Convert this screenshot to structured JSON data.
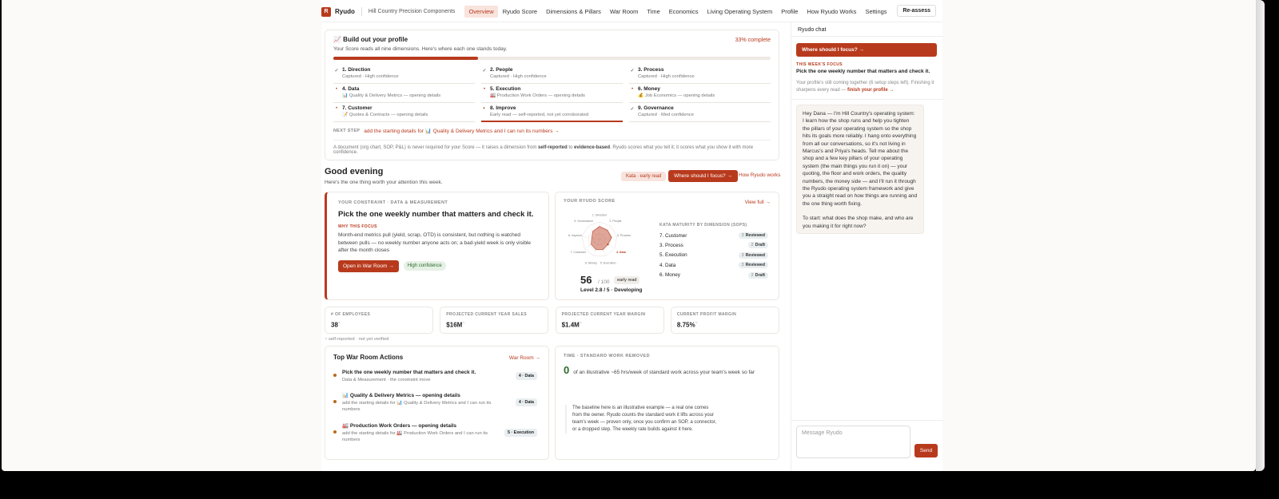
{
  "nav": {
    "logo_letter": "R",
    "brand": "Ryudo",
    "company": "Hill Country Precision Components",
    "items": [
      {
        "label": "Overview",
        "active": true
      },
      {
        "label": "Ryudo Score"
      },
      {
        "label": "Dimensions & Pillars"
      },
      {
        "label": "War Room"
      },
      {
        "label": "Time"
      },
      {
        "label": "Economics"
      },
      {
        "label": "Living Operating System"
      },
      {
        "label": "Profile"
      },
      {
        "label": "How Ryudo Works"
      },
      {
        "label": "Settings"
      }
    ],
    "reassess": "Re-assess"
  },
  "profile": {
    "title": "📈 Build out your profile",
    "percent_label": "33% complete",
    "percent": 0.33,
    "subtitle": "Your Score reads all nine dimensions. Here's where each one stands today.",
    "dimensions": [
      {
        "name": "1. Direction",
        "sub": "Captured · High confidence",
        "mark": "✓",
        "ok": true
      },
      {
        "name": "2. People",
        "sub": "Captured · High confidence",
        "mark": "✓",
        "ok": true
      },
      {
        "name": "3. Process",
        "sub": "Captured · High confidence",
        "mark": "✓",
        "ok": true
      },
      {
        "name": "4. Data",
        "sub": "📊 Quality & Delivery Metrics — opening details",
        "mark": "•",
        "ok": false
      },
      {
        "name": "5. Execution",
        "sub": "🏭 Production Work Orders — opening details",
        "mark": "•",
        "ok": false
      },
      {
        "name": "6. Money",
        "sub": "💰 Job Economics — opening details",
        "mark": "•",
        "ok": false
      },
      {
        "name": "7. Customer",
        "sub": "📝 Quotes & Contracts — opening details",
        "mark": "•",
        "ok": false
      },
      {
        "name": "8. Improve",
        "sub": "Early read — self-reported, not yet corroborated",
        "mark": "◐",
        "ok": false,
        "warn": true
      },
      {
        "name": "9. Governance",
        "sub": "Captured · Med confidence",
        "mark": "✓",
        "ok": true
      }
    ],
    "next_step_label": "NEXT STEP",
    "next_step_link": "add the starting details for 📊 Quality & Delivery Metrics and I can run its numbers →",
    "note_pre": "A document (org chart, SOP, P&L) is never required for your Score — it raises a dimension from ",
    "note_b1": "self-reported",
    "note_mid": " to ",
    "note_b2": "evidence-based",
    "note_post": ". Ryudo scores what you tell it; it scores what you show it with more confidence."
  },
  "greeting": {
    "title": "Good evening",
    "subtitle": "Here's the one thing worth your attention this week.",
    "kata_pill": "Kata · early read",
    "focus_button": "Where should I focus? →",
    "how_link": "How Ryudo works"
  },
  "constraint": {
    "label": "YOUR CONSTRAINT · DATA & MEASUREMENT",
    "title": "Pick the one weekly number that matters and check it.",
    "why_label": "WHY THIS FOCUS",
    "body": "Month-end metrics pull (yield, scrap, OTD) is consistent, but nothing is watched between pulls — no weekly number anyone acts on; a bad-yield week is only visible after the month closes",
    "button": "Open in War Room →",
    "confidence": "High confidence"
  },
  "score": {
    "label": "YOUR RYUDO SCORE",
    "view_full": "View full →",
    "value": "56",
    "denominator": "/ 100",
    "pill": "early read",
    "level": "Level 2.8 / 5 · Developing",
    "radar_labels": [
      "1. Direction",
      "2. People",
      "3. Process",
      "4. Data",
      "5. Execution",
      "6. Money",
      "7. Customer",
      "8. Improve",
      "9. Governance"
    ],
    "radar_values": [
      0.75,
      0.7,
      0.7,
      0.55,
      0.6,
      0.6,
      0.55,
      0.45,
      0.6
    ],
    "maturity_label": "KATA MATURITY BY DIMENSION (SOPS)",
    "maturity": [
      {
        "name": "7. Customer",
        "num": "3",
        "status": "Reviewed"
      },
      {
        "name": "3. Process",
        "num": "2",
        "status": "Draft"
      },
      {
        "name": "5. Execution",
        "num": "3",
        "status": "Reviewed"
      },
      {
        "name": "4. Data",
        "num": "3",
        "status": "Reviewed"
      },
      {
        "name": "6. Money",
        "num": "2",
        "status": "Draft"
      }
    ]
  },
  "metrics": [
    {
      "label": "# OF EMPLOYEES",
      "value": "38",
      "mark": "~"
    },
    {
      "label": "PROJECTED CURRENT YEAR SALES",
      "value": "$16M",
      "mark": "~"
    },
    {
      "label": "PROJECTED CURRENT YEAR MARGIN",
      "value": "$1.4M",
      "mark": "~"
    },
    {
      "label": "CURRENT PROFIT MARGIN",
      "value": "8.75%",
      "mark": "~"
    }
  ],
  "self_note": "~ self-reported · not yet verified",
  "actions": {
    "title": "Top War Room Actions",
    "link": "War Room →",
    "items": [
      {
        "name": "Pick the one weekly number that matters and check it.",
        "sub": "Data & Measurement · the constraint move",
        "badge": "4 · Data"
      },
      {
        "name": "📊 Quality & Delivery Metrics — opening details",
        "sub": "add the starting details for 📊 Quality & Delivery Metrics and I can run its numbers",
        "badge": "4 · Data"
      },
      {
        "name": "🏭 Production Work Orders — opening details",
        "sub": "add the starting details for 🏭 Production Work Orders and I can run its numbers",
        "badge": "5 · Execution"
      }
    ]
  },
  "time": {
    "label": "TIME · STANDARD WORK REMOVED",
    "value": "0",
    "text": "of an illustrative ~65 hrs/week of standard work across your team's week so far",
    "note": "The baseline here is an illustrative example — a real one comes from the owner. Ryudo counts the standard work it lifts across your team's week — proven only, once you confirm an SOP, a connector, or a dropped step. The weekly rate builds against it here."
  },
  "chat": {
    "header": "Ryudo chat",
    "focus_button": "Where should I focus? →",
    "week_label": "THIS WEEK'S FOCUS",
    "week_title": "Pick the one weekly number that matters and check it.",
    "setup_text": "Your profile's still coming together (6 setup steps left). Finishing it sharpens every read — ",
    "setup_link": "finish your profile →",
    "message_p1": "Hey Dana — I'm Hill Country's operating system: I learn how the shop runs and help you tighten the pillars of your operating system so the shop hits its goals more reliably. I hang onto everything from all our conversations, so it's not living in Marcus's and Priya's heads. Tell me about the shop and a few key pillars of your operating system (the main things you run it on) — your quoting, the floor and work orders, the quality numbers, the money side — and I'll run it through the Ryudo operating system framework and give you a straight read on how things are running and the one thing worth fixing.",
    "message_p2": "To start: what does the shop make, and who are you making it for right now?",
    "input_placeholder": "Message Ryudo",
    "send": "Send"
  },
  "colors": {
    "accent": "#b83a1d",
    "positive": "#2c6b2c"
  }
}
